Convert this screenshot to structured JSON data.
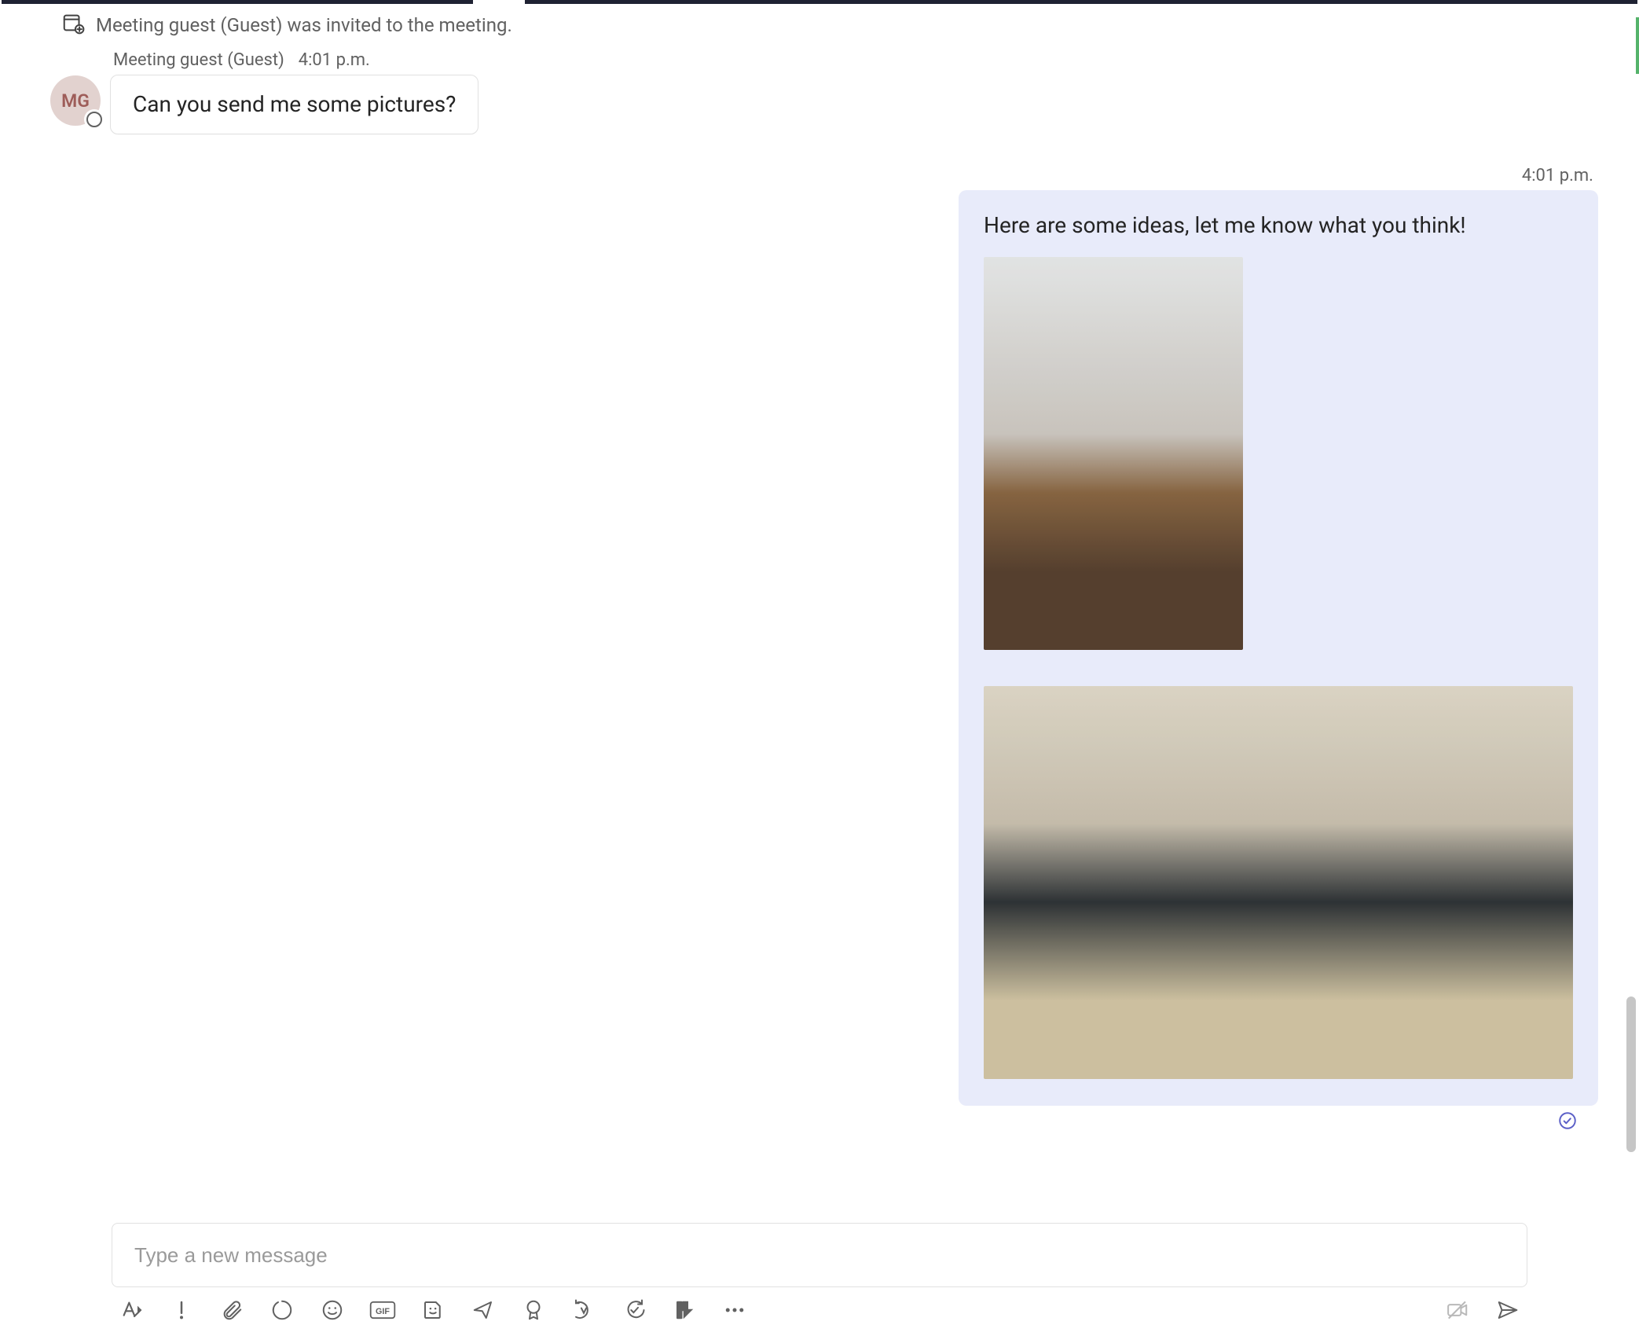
{
  "system_event": {
    "icon": "calendar-add-icon",
    "text": "Meeting guest (Guest) was invited to the meeting."
  },
  "messages": {
    "incoming": {
      "avatar_initials": "MG",
      "sender": "Meeting guest (Guest)",
      "time": "4:01 p.m.",
      "body": "Can you send me some pictures?"
    },
    "outgoing": {
      "time": "4:01 p.m.",
      "body": "Here are some ideas, let me know what you think!",
      "image1_alt": "Living room with wooden coffee table",
      "image2_alt": "Modern kitchen with dark cabinets"
    }
  },
  "compose": {
    "placeholder": "Type a new message"
  },
  "toolbar": {
    "format": "Format",
    "priority": "Set delivery options / Important",
    "attach": "Attach files",
    "loop": "Loop component",
    "emoji": "Emoji",
    "gif_label": "GIF",
    "sticker": "Sticker",
    "share": "Share teams link",
    "approvals": "Approvals",
    "viva": "Viva",
    "update": "Updates",
    "actions": "Actions",
    "more": "More",
    "video": "Record video clip",
    "send": "Send"
  }
}
